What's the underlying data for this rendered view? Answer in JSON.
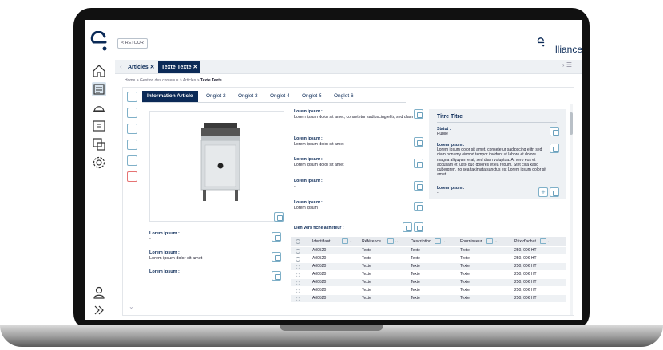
{
  "topbar": {
    "back_label": "< RETOUR",
    "brand": "lliance"
  },
  "tabs": [
    {
      "label": "Articles ✕"
    },
    {
      "label": "Texte Texte ✕"
    }
  ],
  "breadcrumb": {
    "path": "Home > Gestion des contenus > Articles > ",
    "current": "Texte Texte"
  },
  "subtabs": [
    "Information Article",
    "Onglet 2",
    "Onglet 3",
    "Onglet 4",
    "Onglet 5",
    "Onglet 6"
  ],
  "left_fields": [
    {
      "label": "Lorem ipsum :",
      "value": "-"
    },
    {
      "label": "Lorem ipsum :",
      "value": "Lorem ipsum dolor sit amet"
    },
    {
      "label": "Lorem ipsum :",
      "value": "-"
    }
  ],
  "middle_fields": [
    {
      "label": "Lorem ipsum :",
      "value": "Lorem ipsum dolor sit amet, consetetur sadipscing elitr, sed diam"
    },
    {
      "label": "Lorem ipsum :",
      "value": "Lorem ipsum dolor sit amet"
    },
    {
      "label": "Lorem ipsum :",
      "value": "Lorem ipsum dolor sit amet"
    },
    {
      "label": "Lorem ipsum :",
      "value": "-"
    },
    {
      "label": "Lorem ipsum :",
      "value": "Lorem ipsum"
    }
  ],
  "buyer_link_label": "Lien vers fiche acheteur :",
  "card": {
    "title": "Titre Titre",
    "status_label": "Statut :",
    "status_value": "Publié",
    "desc_label": "Lorem ipsum :",
    "desc_value": "Lorem ipsum dolor sit amet, consetetur sadipscing elitr, sed diam nonumy eirmod tempor invidunt ut labore et dolore magna aliquyam erat, sed diam voluptua. At vero eos et accusam et justo duo dolores et ea rebum. Stet clita kasd gubergren, no sea takimata sanctus est Lorem ipsum dolor sit amet.",
    "extra_label": "Lorem ipsum :",
    "extra_value": "-"
  },
  "table": {
    "columns": [
      "Identifiant",
      "Référence",
      "Description",
      "Fournisseur",
      "Prix d'achat"
    ],
    "rows": [
      [
        "A00520",
        "Texte",
        "Texte",
        "Texte",
        "250, 00€ HT"
      ],
      [
        "A00520",
        "Texte",
        "Texte",
        "Texte",
        "250, 00€ HT"
      ],
      [
        "A00520",
        "Texte",
        "Texte",
        "Texte",
        "250, 00€ HT"
      ],
      [
        "A00520",
        "Texte",
        "Texte",
        "Texte",
        "250, 00€ HT"
      ],
      [
        "A00520",
        "Texte",
        "Texte",
        "Texte",
        "250, 00€ HT"
      ],
      [
        "A00520",
        "Texte",
        "Texte",
        "Texte",
        "250, 00€ HT"
      ],
      [
        "A00520",
        "Texte",
        "Texte",
        "Texte",
        "250, 00€ HT"
      ]
    ]
  },
  "colors": {
    "brand": "#0b2a57",
    "accent": "#6aa0bc",
    "danger": "#e57373"
  }
}
